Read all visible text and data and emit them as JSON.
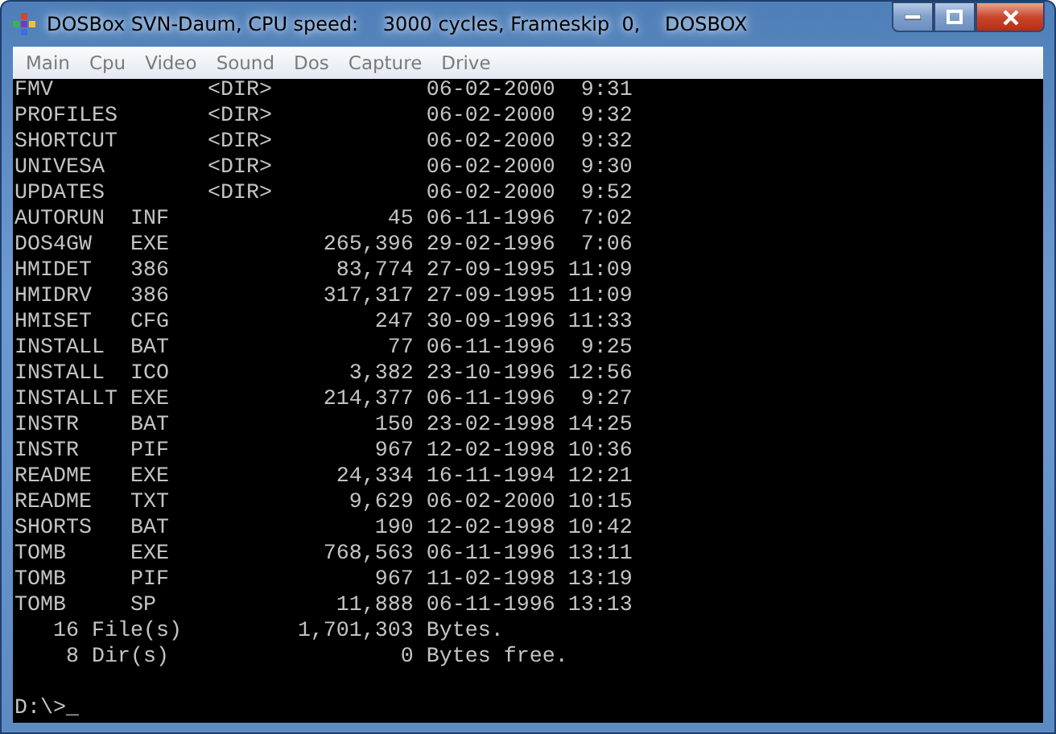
{
  "window": {
    "title": "DOSBox SVN-Daum, CPU speed:    3000 cycles, Frameskip  0,    DOSBOX"
  },
  "menu": [
    "Main",
    "Cpu",
    "Video",
    "Sound",
    "Dos",
    "Capture",
    "Drive"
  ],
  "listing": [
    {
      "kind": "dir",
      "name": "FMV",
      "size": "<DIR>",
      "date": "06-02-2000",
      "time": "9:31"
    },
    {
      "kind": "dir",
      "name": "PROFILES",
      "size": "<DIR>",
      "date": "06-02-2000",
      "time": "9:32"
    },
    {
      "kind": "dir",
      "name": "SHORTCUT",
      "size": "<DIR>",
      "date": "06-02-2000",
      "time": "9:32"
    },
    {
      "kind": "dir",
      "name": "UNIVESA",
      "size": "<DIR>",
      "date": "06-02-2000",
      "time": "9:30"
    },
    {
      "kind": "dir",
      "name": "UPDATES",
      "size": "<DIR>",
      "date": "06-02-2000",
      "time": "9:52"
    },
    {
      "kind": "file",
      "name": "AUTORUN",
      "ext": "INF",
      "size": "45",
      "date": "06-11-1996",
      "time": "7:02"
    },
    {
      "kind": "file",
      "name": "DOS4GW",
      "ext": "EXE",
      "size": "265,396",
      "date": "29-02-1996",
      "time": "7:06"
    },
    {
      "kind": "file",
      "name": "HMIDET",
      "ext": "386",
      "size": "83,774",
      "date": "27-09-1995",
      "time": "11:09"
    },
    {
      "kind": "file",
      "name": "HMIDRV",
      "ext": "386",
      "size": "317,317",
      "date": "27-09-1995",
      "time": "11:09"
    },
    {
      "kind": "file",
      "name": "HMISET",
      "ext": "CFG",
      "size": "247",
      "date": "30-09-1996",
      "time": "11:33"
    },
    {
      "kind": "file",
      "name": "INSTALL",
      "ext": "BAT",
      "size": "77",
      "date": "06-11-1996",
      "time": "9:25"
    },
    {
      "kind": "file",
      "name": "INSTALL",
      "ext": "ICO",
      "size": "3,382",
      "date": "23-10-1996",
      "time": "12:56"
    },
    {
      "kind": "file",
      "name": "INSTALLT",
      "ext": "EXE",
      "size": "214,377",
      "date": "06-11-1996",
      "time": "9:27"
    },
    {
      "kind": "file",
      "name": "INSTR",
      "ext": "BAT",
      "size": "150",
      "date": "23-02-1998",
      "time": "14:25"
    },
    {
      "kind": "file",
      "name": "INSTR",
      "ext": "PIF",
      "size": "967",
      "date": "12-02-1998",
      "time": "10:36"
    },
    {
      "kind": "file",
      "name": "README",
      "ext": "EXE",
      "size": "24,334",
      "date": "16-11-1994",
      "time": "12:21"
    },
    {
      "kind": "file",
      "name": "README",
      "ext": "TXT",
      "size": "9,629",
      "date": "06-02-2000",
      "time": "10:15"
    },
    {
      "kind": "file",
      "name": "SHORTS",
      "ext": "BAT",
      "size": "190",
      "date": "12-02-1998",
      "time": "10:42"
    },
    {
      "kind": "file",
      "name": "TOMB",
      "ext": "EXE",
      "size": "768,563",
      "date": "06-11-1996",
      "time": "13:11"
    },
    {
      "kind": "file",
      "name": "TOMB",
      "ext": "PIF",
      "size": "967",
      "date": "11-02-1998",
      "time": "13:19"
    },
    {
      "kind": "file",
      "name": "TOMB",
      "ext": "SP",
      "size": "11,888",
      "date": "06-11-1996",
      "time": "13:13"
    }
  ],
  "summary": [
    {
      "count": "16",
      "label": "File(s)",
      "bytes": "1,701,303",
      "unit": "Bytes."
    },
    {
      "count": "8",
      "label": "Dir(s)",
      "bytes": "0",
      "unit": "Bytes free."
    }
  ],
  "prompt": "D:\\>",
  "cursor": "_"
}
